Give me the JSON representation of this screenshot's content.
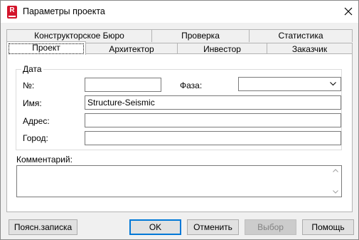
{
  "window": {
    "title": "Параметры проекта",
    "app_icon_letter": "R",
    "accent": "#d3142b"
  },
  "tabs": {
    "back_row": [
      {
        "label": "Конструкторское Бюро"
      },
      {
        "label": "Проверка"
      },
      {
        "label": "Статистика"
      }
    ],
    "front_row": [
      {
        "label": "Проект",
        "active": true
      },
      {
        "label": "Архитектор"
      },
      {
        "label": "Инвестор"
      },
      {
        "label": "Заказчик"
      }
    ]
  },
  "data_group": {
    "legend": "Дата",
    "number_label": "№:",
    "number_value": "",
    "phase_label": "Фаза:",
    "phase_value": "",
    "name_label": "Имя:",
    "name_value": "Structure-Seismic",
    "address_label": "Адрес:",
    "address_value": "",
    "city_label": "Город:",
    "city_value": ""
  },
  "comment": {
    "label": "Комментарий:",
    "value": ""
  },
  "buttons": {
    "notes": "Поясн.записка",
    "ok": "OK",
    "cancel": "Отменить",
    "select": "Выбор",
    "help": "Помощь"
  }
}
